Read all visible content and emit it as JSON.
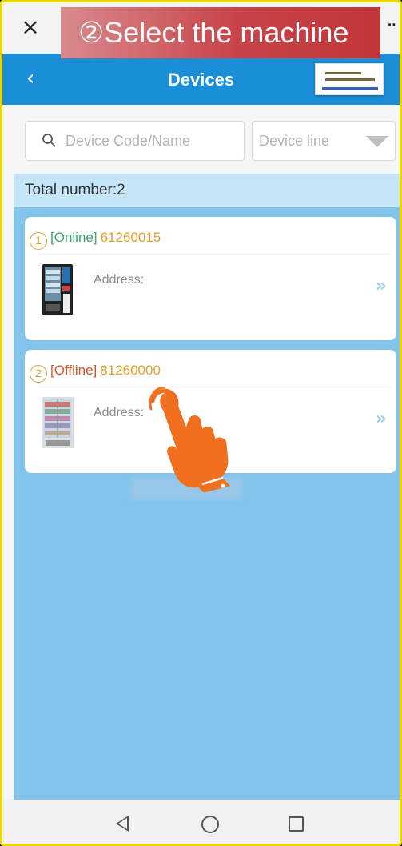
{
  "tutorial": {
    "step_label": "②Select the machine"
  },
  "window": {
    "close_symbol": "×",
    "more_symbol": "··"
  },
  "header": {
    "back_symbol": "‹",
    "title": "Devices"
  },
  "search": {
    "placeholder": "Device Code/Name",
    "line_placeholder": "Device line"
  },
  "list": {
    "total_label": "Total number:2",
    "devices": [
      {
        "index": "1",
        "status": "[Online]",
        "code": "61260015",
        "address_label": "Address:",
        "chevron": "»"
      },
      {
        "index": "2",
        "status": "[Offline]",
        "code": "81260000",
        "address_label": "Address:",
        "chevron": "»"
      }
    ]
  },
  "colors": {
    "header_blue": "#1a8fd8",
    "list_blue": "#82c4ec",
    "online_green": "#3aaa6a",
    "offline_red": "#d4552d",
    "code_gold": "#e2a12a",
    "hand_orange": "#f07020"
  },
  "icons": {
    "search": "search-icon",
    "dropdown": "triangle-down-icon",
    "pointer": "tap-hand-icon"
  }
}
